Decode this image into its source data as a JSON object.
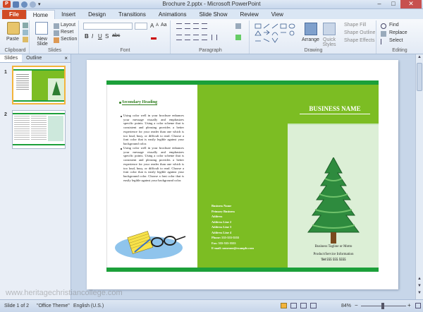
{
  "window": {
    "title": "Brochure 2.pptx - Microsoft PowerPoint",
    "app_icon_letter": "P",
    "minimize": "–",
    "maximize": "□",
    "close": "✕"
  },
  "ribbon_tabs": [
    "File",
    "Home",
    "Insert",
    "Design",
    "Transitions",
    "Animations",
    "Slide Show",
    "Review",
    "View"
  ],
  "ribbon": {
    "clipboard": {
      "paste": "Paste",
      "label": "Clipboard"
    },
    "slides": {
      "new_slide": "New Slide",
      "layout": "Layout",
      "reset": "Reset",
      "section": "Section",
      "label": "Slides"
    },
    "font": {
      "label": "Font",
      "bold": "B",
      "italic": "I",
      "underline": "U",
      "shadow": "S",
      "strike": "abc",
      "grow": "A",
      "shrink": "A",
      "clear": "Aa"
    },
    "paragraph": {
      "label": "Paragraph"
    },
    "drawing": {
      "label": "Drawing",
      "arrange": "Arrange",
      "quick_styles": "Quick Styles",
      "shape_fill": "Shape Fill",
      "shape_outline": "Shape Outline",
      "shape_effects": "Shape Effects"
    },
    "editing": {
      "label": "Editing",
      "find": "Find",
      "replace": "Replace",
      "select": "Select"
    }
  },
  "left_panel": {
    "tabs": [
      "Slides",
      "Outline"
    ],
    "close": "×",
    "slide_numbers": [
      "1",
      "2"
    ]
  },
  "slide": {
    "secondary_heading": "Secondary Heading",
    "bullets": [
      "Using color well in your brochure enhances your message visually and emphasizes specific points. Using a color scheme that is consistent and pleasing provides a better experience for your reader than one which is too loud, busy, or difficult to read. Choose a font color that is easily legible against your background color.",
      "Using color well in your brochure enhances your message visually and emphasizes specific points. Using a color scheme that is consistent and pleasing provides a better experience for your reader than one which is too loud, busy, or difficult to read. Choose a font color that is easily legible against your background color. Choose a font color that is easily legible against your background color."
    ],
    "address": [
      "Business Name",
      "Primary Business",
      "Address",
      "Address Line 2",
      "Address Line 3",
      "Address Line 4",
      "Phone: 555-555-5555",
      "Fax: 555-555-5555",
      "E-mail: someone@example.com"
    ],
    "business_name": "BUSINESS NAME",
    "tagline": "Business Tagline or Motto",
    "product_info": "Product/Service Information",
    "phone": "Tel 555 555 5555"
  },
  "status_bar": {
    "slide": "Slide 1 of 2",
    "theme": "\"Office Theme\"",
    "language": "English (U.S.)",
    "zoom": "84%"
  },
  "watermark": "www.heritagechristiancollege.com",
  "colors": {
    "green_panel": "#7cbd23",
    "dark_green_bar": "#1ca03a",
    "light_green": "#dcefd6",
    "file_tab": "#d14b24"
  }
}
